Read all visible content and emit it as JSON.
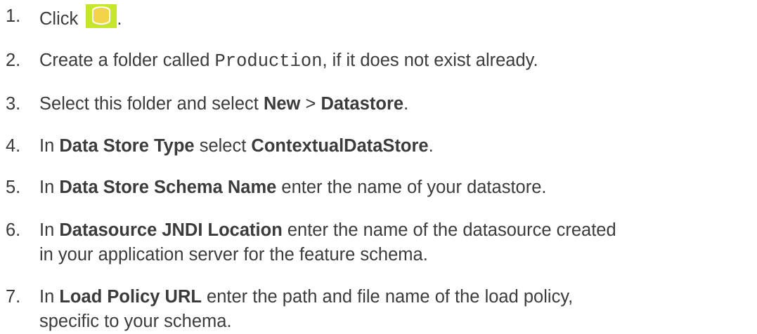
{
  "steps": [
    {
      "num": "1.",
      "pre": "Click ",
      "post": "."
    },
    {
      "num": "2.",
      "pre": "Create a folder called ",
      "code": "Production",
      "post": ", if it does not exist already."
    },
    {
      "num": "3.",
      "pre": "Select this folder and select ",
      "b1": "New",
      "mid": " > ",
      "b2": "Datastore",
      "post": "."
    },
    {
      "num": "4.",
      "pre": "In ",
      "b1": "Data Store Type",
      "mid": " select ",
      "b2": "ContextualDataStore",
      "post": "."
    },
    {
      "num": "5.",
      "pre": "In ",
      "b1": "Data Store Schema Name",
      "post": " enter the name of your datastore."
    },
    {
      "num": "6.",
      "pre": "In ",
      "b1": "Datasource JNDI Location",
      "post": " enter the name of the datasource created",
      "line2": "in your application server for the feature schema."
    },
    {
      "num": "7.",
      "pre": "In ",
      "b1": "Load Policy URL",
      "post": " enter the path and file name of the load policy,",
      "line2": "specific to your schema."
    }
  ],
  "icon": {
    "name": "datastore-icon",
    "bg": "#c6e62c",
    "fg": "#f2d34a"
  }
}
